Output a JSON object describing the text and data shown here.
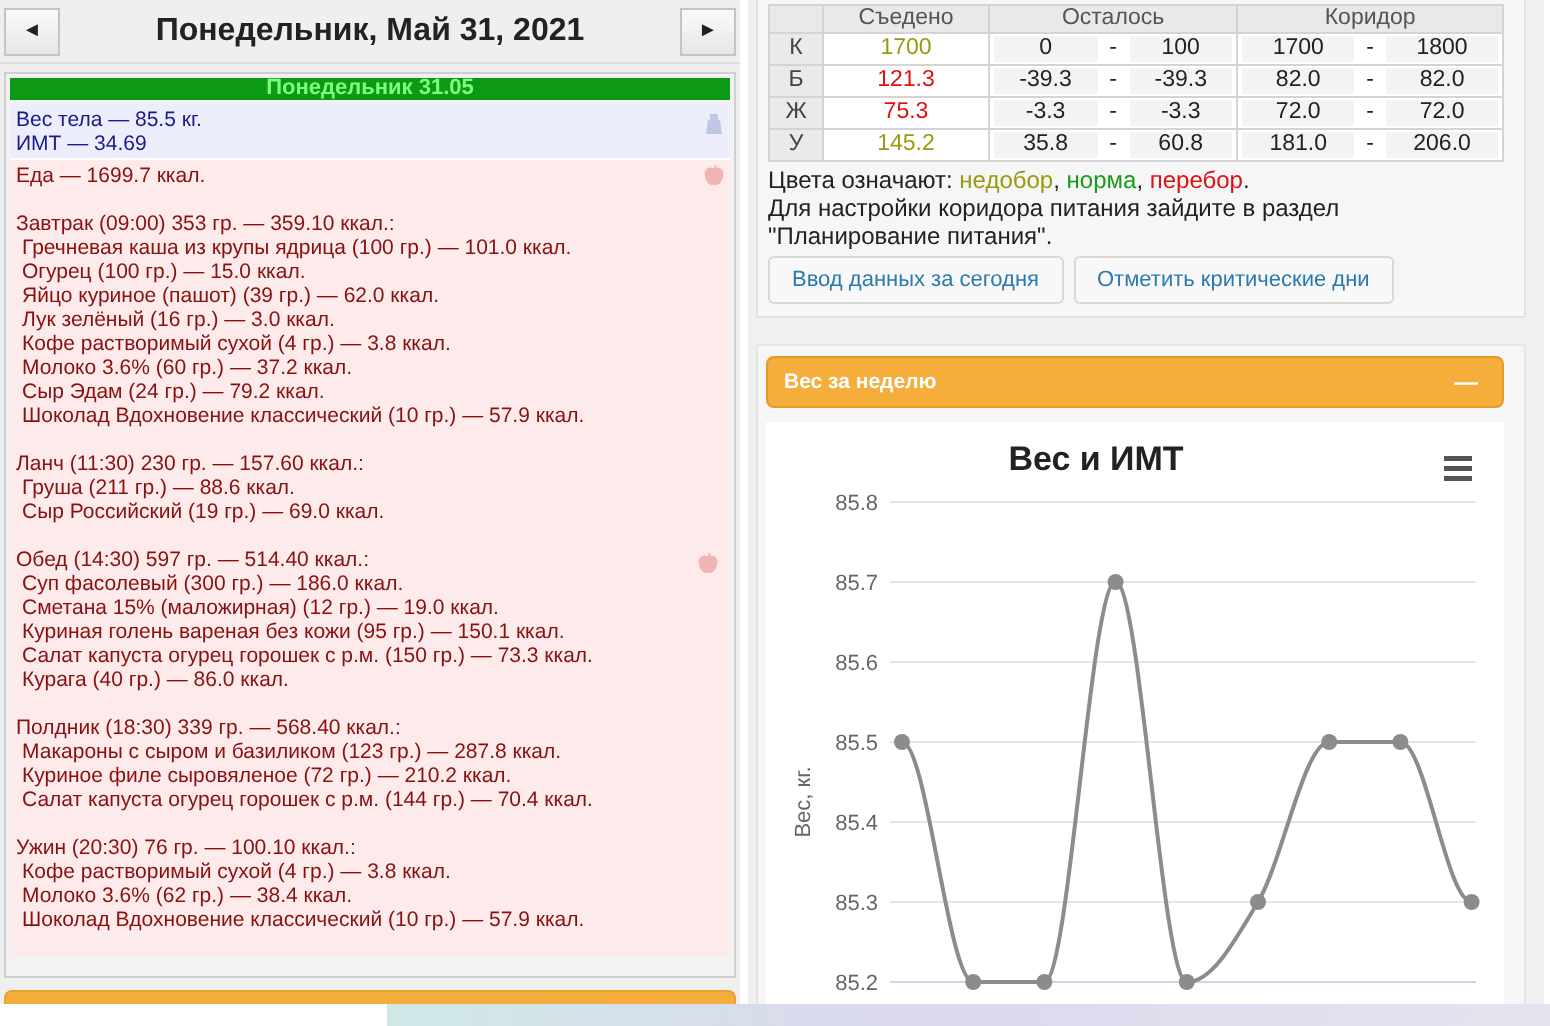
{
  "day": {
    "prev": "◄",
    "title": "Понедельник, Май 31, 2021",
    "next": "►",
    "banner": "Понедельник 31.05",
    "body": [
      "Вес тела — 85.5 кг.",
      "ИМТ — 34.69"
    ],
    "food_total": "Еда — 1699.7 ккал.",
    "meals": [
      {
        "title": "Завтрак (09:00) 353 гр. — 359.10 ккал.:",
        "icon": false,
        "items": [
          "Гречневая каша из крупы ядрица (100 гр.) — 101.0 ккал.",
          "Огурец (100 гр.) — 15.0 ккал.",
          "Яйцо куриное (пашот) (39 гр.) — 62.0 ккал.",
          "Лук зелёный (16 гр.) — 3.0 ккал.",
          "Кофе растворимый сухой (4 гр.) — 3.8 ккал.",
          "Молоко 3.6% (60 гр.) — 37.2 ккал.",
          "Сыр Эдам (24 гр.) — 79.2 ккал.",
          "Шоколад Вдохновение классический (10 гр.) — 57.9 ккал."
        ]
      },
      {
        "title": "Ланч (11:30) 230 гр. — 157.60 ккал.:",
        "icon": false,
        "items": [
          "Груша (211 гр.) — 88.6 ккал.",
          "Сыр Российский (19 гр.) — 69.0 ккал."
        ]
      },
      {
        "title": "Обед (14:30) 597 гр. — 514.40 ккал.:",
        "icon": true,
        "items": [
          "Суп фасолевый (300 гр.) — 186.0 ккал.",
          "Сметана 15% (маложирная) (12 гр.) — 19.0 ккал.",
          "Куриная голень вареная без кожи (95 гр.) — 150.1 ккал.",
          "Салат капуста огурец горошек с р.м. (150 гр.) — 73.3 ккал.",
          "Курага (40 гр.) — 86.0 ккал."
        ]
      },
      {
        "title": "Полдник (18:30) 339 гр. — 568.40 ккал.:",
        "icon": false,
        "items": [
          "Макароны с сыром и базиликом (123 гр.) — 287.8 ккал.",
          "Куриное филе сыровяленое (72 гр.) — 210.2 ккал.",
          "Салат капуста огурец горошек с р.м. (144 гр.) — 70.4 ккал."
        ]
      },
      {
        "title": "Ужин (20:30) 76 гр. — 100.10 ккал.:",
        "icon": false,
        "items": [
          "Кофе растворимый сухой (4 гр.) — 3.8 ккал.",
          "Молоко 3.6% (62 гр.) — 38.4 ккал.",
          "Шоколад Вдохновение классический (10 гр.) — 57.9 ккал."
        ]
      }
    ]
  },
  "nutrition": {
    "columns": [
      "Съедено",
      "Осталось",
      "Коридор"
    ],
    "rows": [
      {
        "label": "К",
        "eaten": "1700",
        "color": "#9a9a10",
        "left_from": "0",
        "left_to": "100",
        "range_from": "1700",
        "range_to": "1800"
      },
      {
        "label": "Б",
        "eaten": "121.3",
        "color": "#e01010",
        "left_from": "-39.3",
        "left_to": "-39.3",
        "range_from": "82.0",
        "range_to": "82.0"
      },
      {
        "label": "Ж",
        "eaten": "75.3",
        "color": "#e01010",
        "left_from": "-3.3",
        "left_to": "-3.3",
        "range_from": "72.0",
        "range_to": "72.0"
      },
      {
        "label": "У",
        "eaten": "145.2",
        "color": "#9a9a10",
        "left_from": "35.8",
        "left_to": "60.8",
        "range_from": "181.0",
        "range_to": "206.0"
      }
    ],
    "dash": "-",
    "legend": {
      "label": "Цвета означают:",
      "items": [
        {
          "text": "недобор",
          "color": "#9a9a10"
        },
        {
          "text": "норма",
          "color": "#1a9a1a"
        },
        {
          "text": "перебор",
          "color": "#e01010"
        }
      ],
      "separator": ",",
      "end": "."
    },
    "note": "Для настройки коридора питания зайдите в раздел \"Планирование питания\".",
    "buttons": [
      "Ввод данных за сегодня",
      "Отметить критические дни"
    ]
  },
  "weight_panel": {
    "title": "Вес за неделю",
    "collapse": "—",
    "chart_data": {
      "type": "line",
      "title": "Вес и ИМТ",
      "ylabel": "Вес, кг.",
      "ylim": [
        85.2,
        85.8
      ],
      "yticks": [
        85.2,
        85.3,
        85.4,
        85.5,
        85.6,
        85.7,
        85.8
      ],
      "grid": true,
      "series": [
        {
          "color": "#8c8c8c",
          "marker": true,
          "values": [
            85.5,
            85.2,
            85.2,
            85.7,
            85.2,
            85.3,
            85.5,
            85.5,
            85.3
          ]
        }
      ]
    }
  }
}
